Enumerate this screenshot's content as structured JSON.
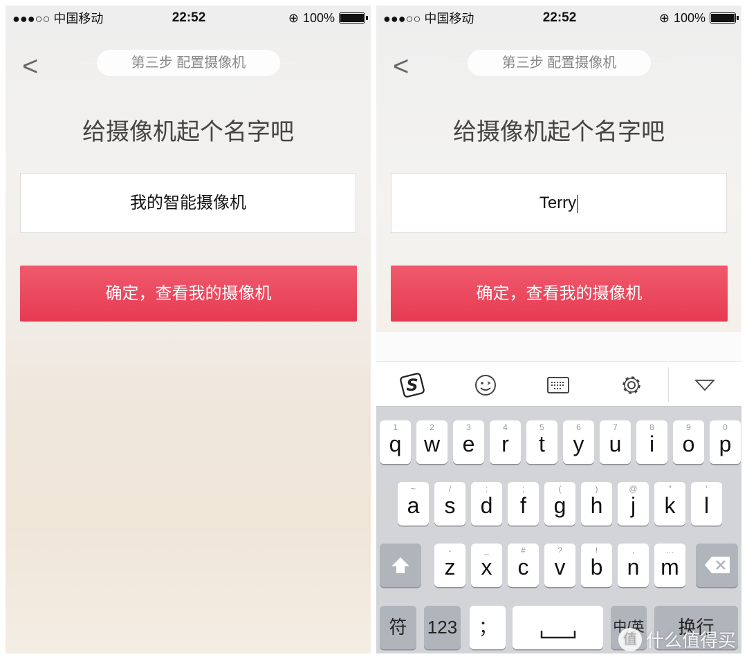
{
  "status": {
    "carrier": "●●●○○ 中国移动",
    "time": "22:52",
    "battery": "100%"
  },
  "header": {
    "step": "第三步 配置摄像机",
    "title": "给摄像机起个名字吧"
  },
  "left": {
    "name_value": "我的智能摄像机"
  },
  "right": {
    "name_value": "Terry"
  },
  "confirm_label": "确定，查看我的摄像机",
  "colors": {
    "accent": "#e8415a",
    "keyboard_bg": "#d2d4d8"
  },
  "keyboard": {
    "toolbar": [
      "sogou-logo-icon",
      "emoji-icon",
      "keyboard-icon",
      "settings-icon",
      "collapse-icon"
    ],
    "row1": [
      [
        "q",
        "1"
      ],
      [
        "w",
        "2"
      ],
      [
        "e",
        "3"
      ],
      [
        "r",
        "4"
      ],
      [
        "t",
        "5"
      ],
      [
        "y",
        "6"
      ],
      [
        "u",
        "7"
      ],
      [
        "i",
        "8"
      ],
      [
        "o",
        "9"
      ],
      [
        "p",
        "0"
      ]
    ],
    "row2": [
      [
        "a",
        "~"
      ],
      [
        "s",
        "/"
      ],
      [
        "d",
        ":"
      ],
      [
        "f",
        ";"
      ],
      [
        "g",
        "("
      ],
      [
        "h",
        ")"
      ],
      [
        "j",
        "@"
      ],
      [
        "k",
        "\""
      ],
      [
        "l",
        "'"
      ]
    ],
    "row3": [
      [
        "z",
        "-"
      ],
      [
        "x",
        "_"
      ],
      [
        "c",
        "#"
      ],
      [
        "v",
        "?"
      ],
      [
        "b",
        "!"
      ],
      [
        "n",
        ","
      ],
      [
        "m",
        "…"
      ]
    ],
    "symbols": "符",
    "numbers": "123",
    "punct": "；",
    "lang": "中/英",
    "return": "换行"
  },
  "watermark": {
    "badge": "值",
    "text": "什么值得买"
  }
}
